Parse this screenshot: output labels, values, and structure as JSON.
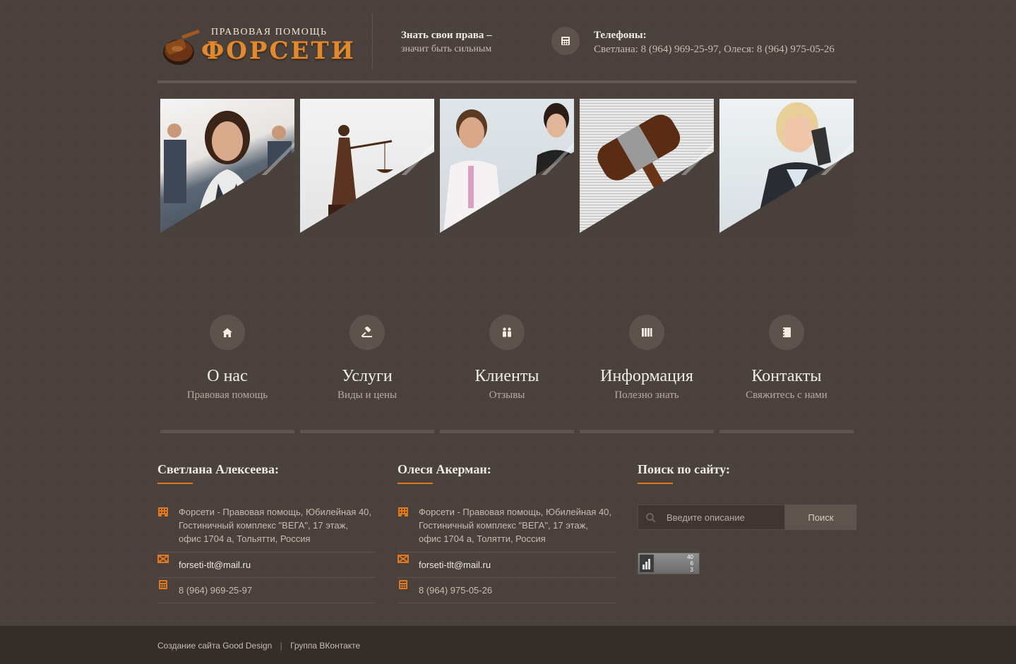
{
  "header": {
    "logo_top": "ПРАВОВАЯ ПОМОЩЬ",
    "logo_main": "ФОРСЕТИ",
    "slogan_line1": "Знать свои права –",
    "slogan_line2": "значит быть сильным",
    "phones_title": "Телефоны:",
    "phones_text": "Светлана: 8 (964) 969-25-97, Олеся: 8 (964) 975-05-26"
  },
  "nav": [
    {
      "title": "О нас",
      "subtitle": "Правовая помощь",
      "icon": "home-icon"
    },
    {
      "title": "Услуги",
      "subtitle": "Виды и цены",
      "icon": "gavel-icon"
    },
    {
      "title": "Клиенты",
      "subtitle": "Отзывы",
      "icon": "people-icon"
    },
    {
      "title": "Информация",
      "subtitle": "Полезно знать",
      "icon": "books-icon"
    },
    {
      "title": "Контакты",
      "subtitle": "Свяжитесь с нами",
      "icon": "notebook-icon"
    }
  ],
  "contacts": [
    {
      "title": "Светлана Алексеева:",
      "address_line1": "Форсети - Правовая помощь, Юбилейная 40,",
      "address_line2": "Гостиничный комплекс \"ВЕГА\", 17 этаж,",
      "address_line3": "офис 1704 а, Тольятти, Россия",
      "email": "forseti-tlt@mail.ru",
      "phone": "8 (964) 969-25-97"
    },
    {
      "title": "Олеся Акерман:",
      "address_line1": "Форсети - Правовая помощь, Юбилейная 40,",
      "address_line2": "Гостиничный комплекс \"ВЕГА\", 17 этаж,",
      "address_line3": "офис 1704 а, Толятти, Россия",
      "email": "forseti-tlt@mail.ru",
      "phone": "8 (964) 975-05-26"
    }
  ],
  "search": {
    "title": "Поиск по сайту:",
    "placeholder": "Введите описание",
    "button": "Поиск"
  },
  "counter": {
    "line1": "40",
    "line2": "6",
    "line3": "3"
  },
  "footer": {
    "link1": "Создание сайта Good Design",
    "separator": "|",
    "link2": "Группа ВКонтакте"
  },
  "colors": {
    "accent": "#e0781e",
    "background": "#4a403b",
    "footer": "#352d29"
  }
}
